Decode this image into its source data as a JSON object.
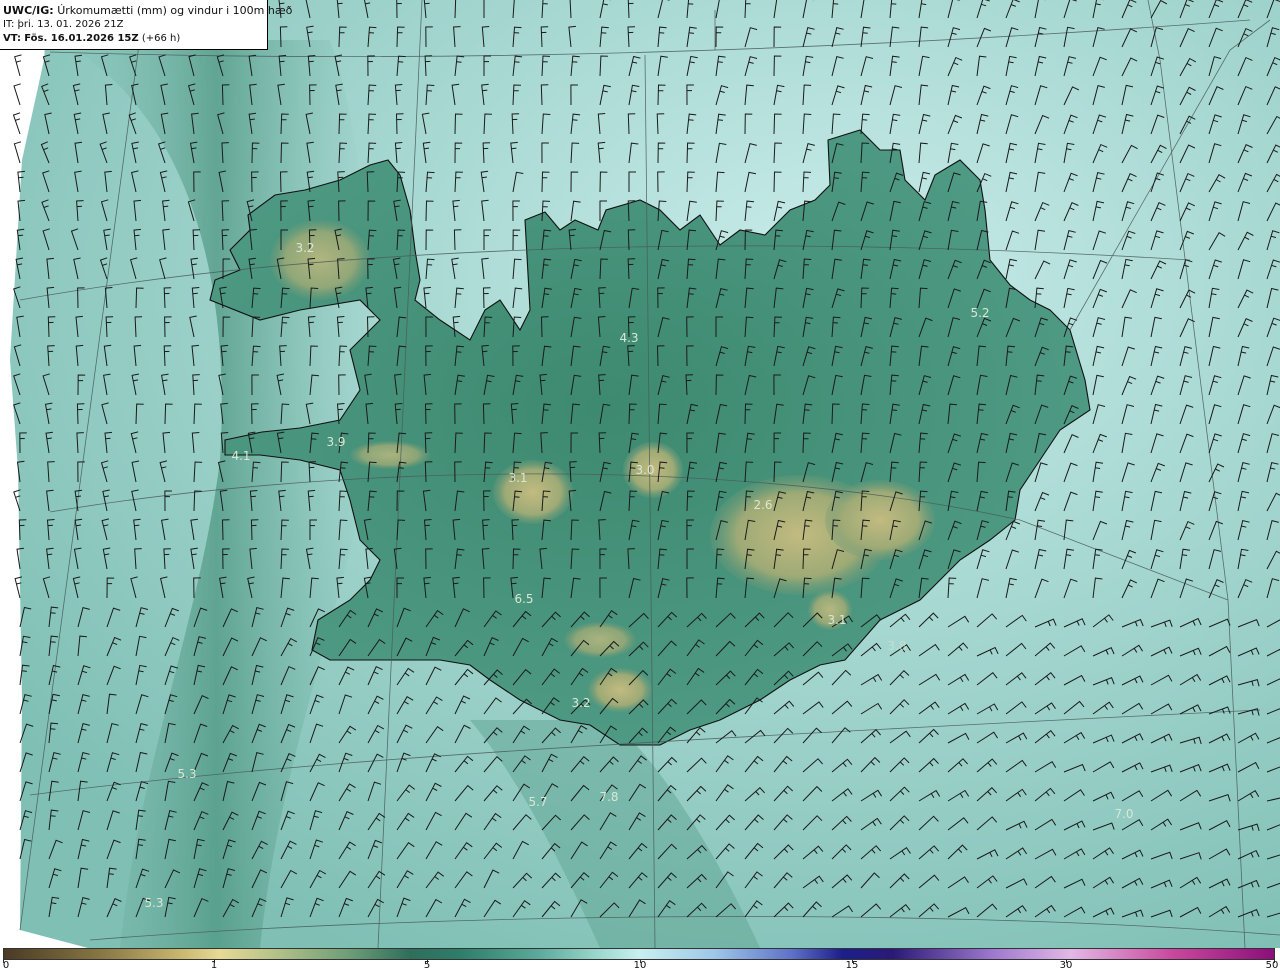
{
  "header": {
    "product_code": "UWC/IG:",
    "title": "Úrkomumætti (mm) og vindur i 100m hæð",
    "issue_time": "IT: þri. 13. 01. 2026 21Z",
    "valid_label": "VT:",
    "valid_time": "Fös. 16.01.2026 15Z",
    "lead_time": "(+66 h)"
  },
  "map_values": [
    {
      "id": "westfjords-north",
      "text": "3.2"
    },
    {
      "id": "west-snaefellsnes-tip",
      "text": "4.1"
    },
    {
      "id": "west-snaefellsnes",
      "text": "3.9"
    },
    {
      "id": "north-central",
      "text": "4.3"
    },
    {
      "id": "east",
      "text": "5.2"
    },
    {
      "id": "central-west",
      "text": "3.1"
    },
    {
      "id": "central",
      "text": "3.0"
    },
    {
      "id": "vatnajokull",
      "text": "2.6"
    },
    {
      "id": "southeast",
      "text": "3.1"
    },
    {
      "id": "south-interior",
      "text": "6.5"
    },
    {
      "id": "south-coast",
      "text": "3.2"
    },
    {
      "id": "offshore-sw",
      "text": "5.3"
    },
    {
      "id": "offshore-south",
      "text": "5.7"
    },
    {
      "id": "offshore-south-2",
      "text": "7.8"
    },
    {
      "id": "offshore-se",
      "text": "7.0"
    },
    {
      "id": "offshore-far-sw",
      "text": "5.3"
    },
    {
      "id": "offshore-se-faint",
      "text": "3.8"
    }
  ],
  "colorbar": {
    "ticks": [
      {
        "label": "0",
        "value": 0
      },
      {
        "label": "1",
        "value": 1
      },
      {
        "label": "5",
        "value": 5
      },
      {
        "label": "10",
        "value": 10
      },
      {
        "label": "15",
        "value": 15
      },
      {
        "label": "30",
        "value": 30
      },
      {
        "label": "50",
        "value": 50
      }
    ]
  },
  "colors": {
    "ocean_light": "#a8dcd6",
    "ocean_mid": "#7cc0b5",
    "land_dark": "#2f7a62",
    "highland_yellow": "#b9b679",
    "coastline": "#111111",
    "barb": "#1a1a1a"
  }
}
